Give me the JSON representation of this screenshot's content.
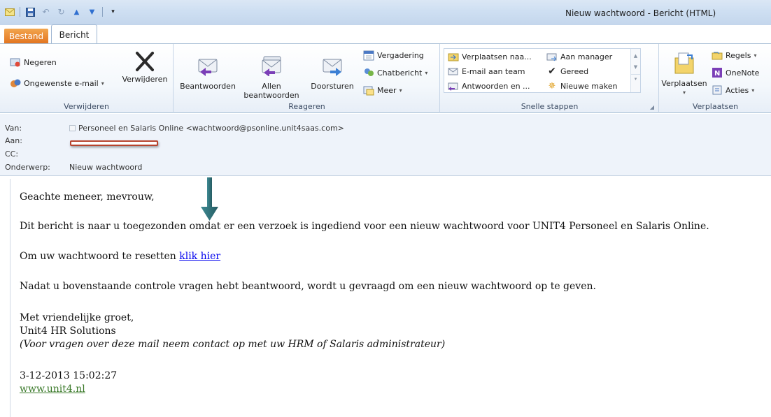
{
  "window": {
    "title": "Nieuw wachtwoord - Bericht (HTML)"
  },
  "tabs": {
    "file": "Bestand",
    "message": "Bericht"
  },
  "ribbon": {
    "delete_group": {
      "label": "Verwijderen",
      "ignore": "Negeren",
      "junk": "Ongewenste e-mail",
      "delete": "Verwijderen"
    },
    "respond_group": {
      "label": "Reageren",
      "reply": "Beantwoorden",
      "reply_all_line1": "Allen",
      "reply_all_line2": "beantwoorden",
      "forward": "Doorsturen",
      "meeting": "Vergadering",
      "chat": "Chatbericht",
      "more": "Meer"
    },
    "quick_steps": {
      "label": "Snelle stappen",
      "move_to": "Verplaatsen naa...",
      "to_manager": "Aan manager",
      "team_email": "E-mail aan team",
      "done": "Gereed",
      "reply_delete": "Antwoorden en ...",
      "create_new": "Nieuwe maken"
    },
    "move_group": {
      "label": "Verplaatsen",
      "move": "Verplaatsen",
      "rules": "Regels",
      "onenote": "OneNote",
      "actions": "Acties"
    }
  },
  "header": {
    "from_label": "Van:",
    "from_value": "Personeel en Salaris Online <wachtwoord@psonline.unit4saas.com>",
    "to_label": "Aan:",
    "cc_label": "CC:",
    "subject_label": "Onderwerp:",
    "subject_value": "Nieuw wachtwoord"
  },
  "body": {
    "greeting": "Geachte meneer, mevrouw,",
    "p1": "Dit bericht is naar u toegezonden omdat er een verzoek is ingediend voor een nieuw wachtwoord voor UNIT4 Personeel en Salaris Online.",
    "p2_prefix": "Om uw wachtwoord te resetten ",
    "p2_link": "klik hier",
    "p3": "Nadat u bovenstaande controle vragen hebt beantwoord, wordt u gevraagd om een nieuw wachtwoord op te geven.",
    "closing": "Met vriendelijke groet,",
    "company": "Unit4 HR Solutions",
    "note": "(Voor vragen over deze mail neem contact op met uw HRM of Salaris administrateur)",
    "datetime": "3-12-2013 15:02:27",
    "website": "www.unit4.nl"
  },
  "colors": {
    "file_tab": "#e2731f",
    "annotation_arrow": "#2e6b73",
    "redaction": "#b7442f",
    "link": "#0000ee"
  }
}
